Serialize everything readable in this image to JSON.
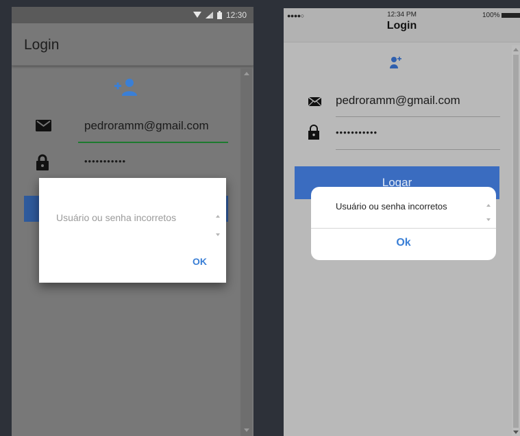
{
  "android": {
    "status_time": "12:30",
    "title": "Login",
    "email_value": "pedroramm@gmail.com",
    "password_value": "•••••••••••",
    "dialog": {
      "message": "Usuário ou senha incorretos",
      "ok_label": "OK"
    },
    "colors": {
      "button": "#2e5a9c",
      "email_underline": "#1c7a2e",
      "ok_text": "#3a7fd6"
    }
  },
  "ios": {
    "signal": "●●●●○",
    "status_time": "12:34 PM",
    "battery_text": "100%",
    "title": "Login",
    "email_value": "pedroramm@gmail.com",
    "password_value": "•••••••••••",
    "button_label": "Logar",
    "dialog": {
      "message": "Usuário ou senha incorretos",
      "ok_label": "Ok"
    },
    "colors": {
      "button": "#3a6cc0",
      "ok_text": "#3a7fd6"
    }
  },
  "icons": [
    "wifi-icon",
    "signal-icon",
    "battery-icon",
    "add-user-icon",
    "mail-icon",
    "lock-icon"
  ]
}
